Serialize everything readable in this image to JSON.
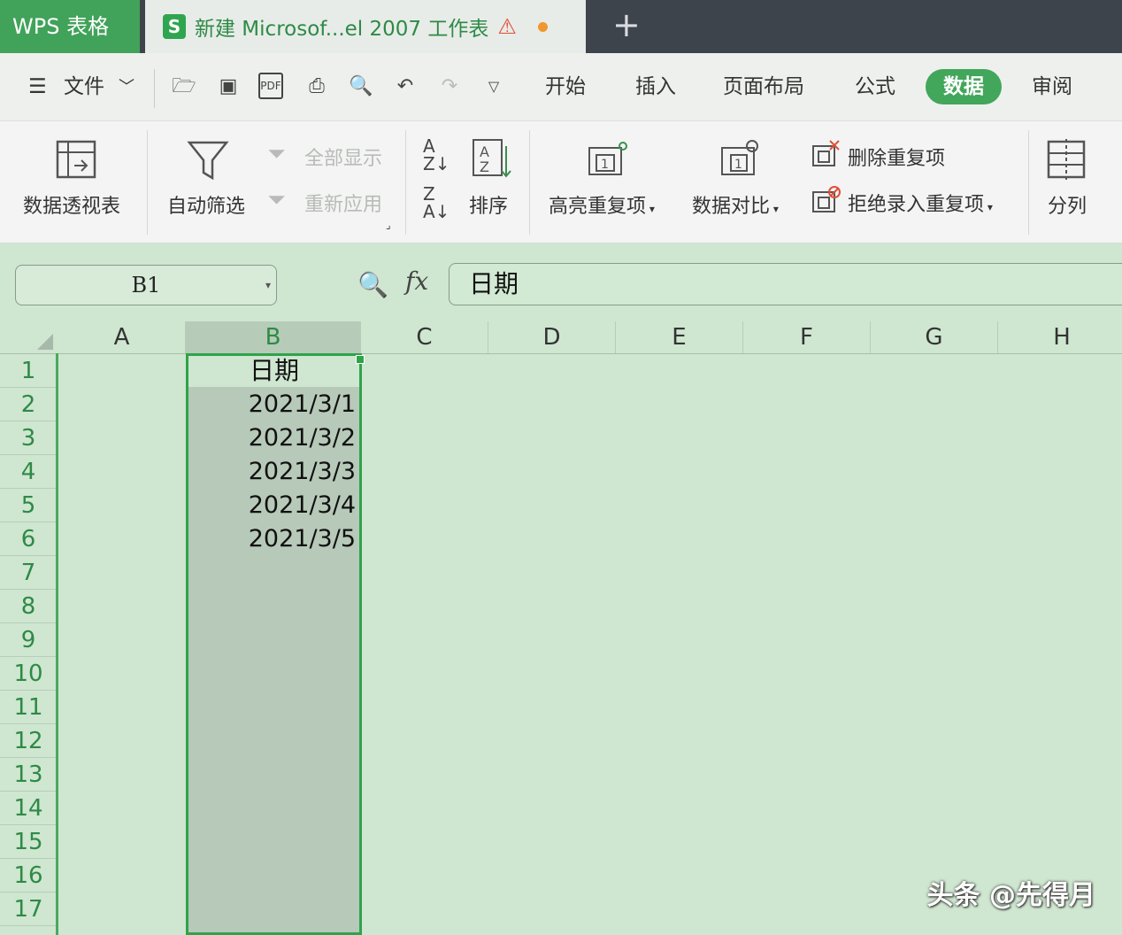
{
  "title_bar": {
    "app_tab": "WPS 表格",
    "doc_tab": "新建 Microsof...el 2007 工作表",
    "new_tab": "+"
  },
  "menu": {
    "file": "文件",
    "tabs": [
      "开始",
      "插入",
      "页面布局",
      "公式",
      "数据",
      "审阅"
    ],
    "active_tab": "数据"
  },
  "ribbon": {
    "pivot": "数据透视表",
    "autofilter": "自动筛选",
    "show_all": "全部显示",
    "reapply": "重新应用",
    "sort_asc": "A↓Z",
    "sort_desc": "Z↓A",
    "sort": "排序",
    "highlight_dup": "高亮重复项",
    "compare": "数据对比",
    "remove_dup": "删除重复项",
    "reject_dup": "拒绝录入重复项",
    "split": "分列"
  },
  "formula_bar": {
    "name_box": "B1",
    "fx": "fx",
    "content": "日期"
  },
  "grid": {
    "columns": [
      "A",
      "B",
      "C",
      "D",
      "E",
      "F",
      "G",
      "H"
    ],
    "selected_column": "B",
    "rows": [
      "1",
      "2",
      "3",
      "4",
      "5",
      "6",
      "7",
      "8",
      "9",
      "10",
      "11",
      "12",
      "13",
      "14",
      "15",
      "16",
      "17"
    ],
    "column_b": [
      "日期",
      "2021/3/1",
      "2021/3/2",
      "2021/3/3",
      "2021/3/4",
      "2021/3/5"
    ]
  },
  "watermark": "头条 @先得月",
  "colors": {
    "accent": "#42a65b",
    "sheet_bg": "#cfe6d0",
    "selection": "#b7c9b8",
    "titlebar": "#3e444c"
  }
}
